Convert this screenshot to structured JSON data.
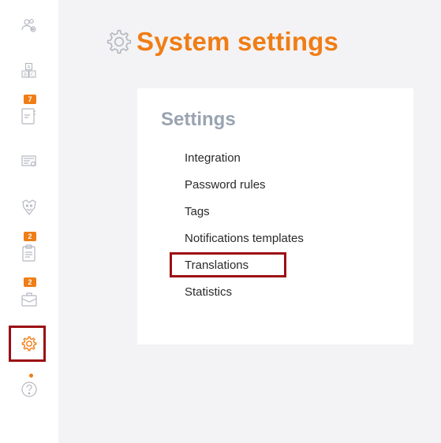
{
  "header": {
    "title": "System settings"
  },
  "settings": {
    "title": "Settings",
    "items": [
      {
        "label": "Integration"
      },
      {
        "label": "Password rules"
      },
      {
        "label": "Tags"
      },
      {
        "label": "Notifications templates"
      },
      {
        "label": "Translations",
        "highlighted": true
      },
      {
        "label": "Statistics"
      }
    ]
  },
  "sidebar": {
    "items": [
      {
        "icon": "users-settings-icon"
      },
      {
        "icon": "alphabet-blocks-icon"
      },
      {
        "icon": "notebook-icon",
        "badge": "7"
      },
      {
        "icon": "monitor-card-icon"
      },
      {
        "icon": "shield-emblem-icon"
      },
      {
        "icon": "clipboard-icon",
        "badge": "2"
      },
      {
        "icon": "briefcase-icon",
        "badge": "2"
      },
      {
        "icon": "gear-icon",
        "active": true
      },
      {
        "icon": "help-icon",
        "notification_dot": true
      }
    ]
  },
  "colors": {
    "accent": "#f07d15",
    "highlight_border": "#9c0f14",
    "icon_gray": "#b4b8c0",
    "card_title": "#9aa3b1"
  }
}
